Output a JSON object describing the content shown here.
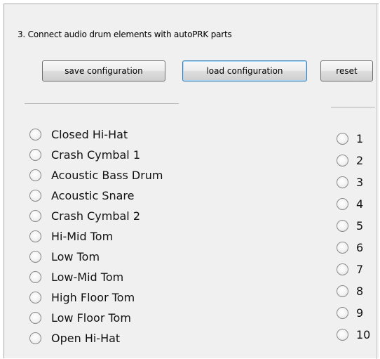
{
  "heading": "3. Connect audio drum elements with autoPRK parts",
  "buttons": {
    "save": "save configuration",
    "load": "load configuration",
    "reset": "reset"
  },
  "drum_elements": [
    {
      "label": "Closed Hi-Hat",
      "selected": false
    },
    {
      "label": "Crash Cymbal 1",
      "selected": false
    },
    {
      "label": "Acoustic Bass Drum",
      "selected": false
    },
    {
      "label": "Acoustic Snare",
      "selected": false
    },
    {
      "label": "Crash Cymbal 2",
      "selected": false
    },
    {
      "label": "Hi-Mid Tom",
      "selected": false
    },
    {
      "label": "Low Tom",
      "selected": false
    },
    {
      "label": "Low-Mid Tom",
      "selected": false
    },
    {
      "label": "High Floor Tom",
      "selected": false
    },
    {
      "label": "Low Floor Tom",
      "selected": false
    },
    {
      "label": "Open Hi-Hat",
      "selected": false
    }
  ],
  "autoprk_parts": [
    {
      "label": "1",
      "selected": false
    },
    {
      "label": "2",
      "selected": false
    },
    {
      "label": "3",
      "selected": false
    },
    {
      "label": "4",
      "selected": false
    },
    {
      "label": "5",
      "selected": false
    },
    {
      "label": "6",
      "selected": false
    },
    {
      "label": "7",
      "selected": false
    },
    {
      "label": "8",
      "selected": false
    },
    {
      "label": "9",
      "selected": false
    },
    {
      "label": "10",
      "selected": false
    }
  ],
  "colors": {
    "panel_background": "#f0f0f0",
    "focus_border": "#3c7fb1"
  }
}
